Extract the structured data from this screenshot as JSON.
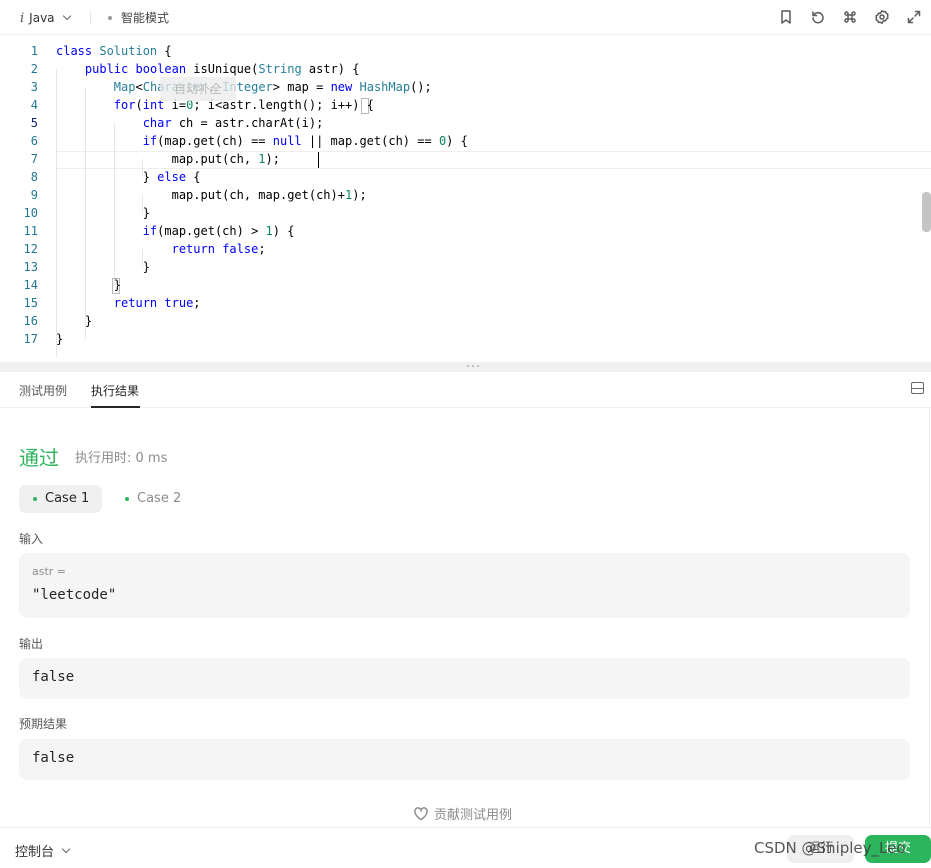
{
  "toolbar": {
    "language": "Java",
    "language_icon": "i",
    "mode": "智能模式",
    "icons": [
      "bookmark-icon",
      "reset-icon",
      "command-icon",
      "settings-icon",
      "expand-icon"
    ]
  },
  "editor": {
    "autocomplete_chip": "自动补全",
    "active_line": 5,
    "line_numbers": [
      "1",
      "2",
      "3",
      "4",
      "5",
      "6",
      "7",
      "8",
      "9",
      "10",
      "11",
      "12",
      "13",
      "14",
      "15",
      "16",
      "17"
    ],
    "lines": [
      "class Solution {",
      "    public boolean isUnique(String astr) {",
      "        Map<Character, Integer> map = new HashMap();",
      "        for(int i=0; i<astr.length(); i++) {",
      "            char ch = astr.charAt(i);",
      "            if(map.get(ch) == null || map.get(ch) == 0) {",
      "                map.put(ch, 1);",
      "            } else {",
      "                map.put(ch, map.get(ch)+1);",
      "            }",
      "            if(map.get(ch) > 1) {",
      "                return false;",
      "            }",
      "        }",
      "        return true;",
      "    }",
      "}"
    ]
  },
  "result_panel": {
    "tabs": [
      {
        "label": "测试用例",
        "active": false
      },
      {
        "label": "执行结果",
        "active": true
      }
    ],
    "status": "通过",
    "runtime": "执行用时: 0 ms",
    "cases": [
      {
        "label": "Case 1",
        "selected": true
      },
      {
        "label": "Case 2",
        "selected": false
      }
    ],
    "input_label": "输入",
    "input_var": "astr =",
    "input_value": "\"leetcode\"",
    "output_label": "输出",
    "output_value": "false",
    "expected_label": "预期结果",
    "expected_value": "false",
    "contribute": "贡献测试用例"
  },
  "bottombar": {
    "console": "控制台",
    "run": "运行",
    "submit": "提交",
    "watermark": "CSDN @Shipley_Leo"
  },
  "colors": {
    "accent_green": "#2db55d",
    "keyword_blue": "#0000ff",
    "type_teal": "#267f99",
    "number_green": "#098658",
    "line_number": "#237893"
  }
}
